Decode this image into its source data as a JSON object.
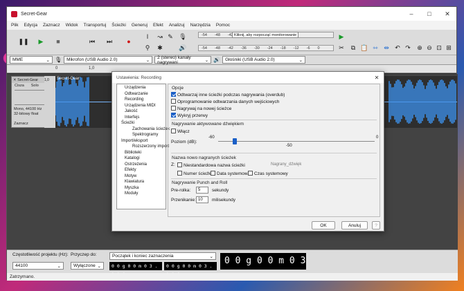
{
  "window": {
    "title": "Secret-Gear"
  },
  "menu": [
    "Plik",
    "Edycja",
    "Zaznacz",
    "Widok",
    "Transportuj",
    "Ścieżki",
    "Generuj",
    "Efekt",
    "Analizuj",
    "Narzędzia",
    "Pomoc"
  ],
  "meters": {
    "rec_ticks": [
      "-54",
      "-48",
      "-42"
    ],
    "rec_hint": "Kliknij, aby rozpocząć monitorowanie",
    "rec_ticks2": [
      "-18",
      "-12",
      "-6",
      "0"
    ],
    "play_ticks": [
      "-54",
      "-48",
      "-42",
      "-36",
      "-30",
      "-24",
      "-18",
      "-12",
      "-6",
      "0"
    ]
  },
  "devices": {
    "host": "MME",
    "mic": "Mikrofon (USB Audio 2.0)",
    "channels": "2 (stereo) kanały nagrywani",
    "speaker": "Głośniki (USB Audio 2.0)"
  },
  "ruler": {
    "labels": [
      "0",
      "1,0"
    ]
  },
  "track": {
    "name": "Secret-Gear",
    "mute": "Cisza",
    "solo": "Solo",
    "info": "Mono, 44100 Hz\n32-bitowy float",
    "select": "Zaznacz",
    "scale": [
      "1,0",
      "0,5",
      "0,0",
      "-0,5",
      "-1,0"
    ]
  },
  "wave_label": "Secret-Gear",
  "dialog": {
    "title": "Ustawienia: Recording",
    "tree": [
      "Urządzenia",
      "Odtwarzanie",
      "Recording",
      "Urządzenia MIDI",
      "Jakość",
      "Interfejs",
      "Ścieżki",
      "Zachowania ścieżek",
      "Spektrogramy",
      "Import/eksport",
      "Rozszerzony import",
      "Biblioteki",
      "Katalogi",
      "Ostrzeżenia",
      "Efekty",
      "Motyw",
      "Klawiatura",
      "Myszka",
      "Moduły"
    ],
    "opcje": "Opcje",
    "opt1": "Odtwarzaj inne ścieżki podczas nagrywania (overdub)",
    "opt2": "Oprogramowanie odtwarzania danych wejściowych",
    "opt3": "Nagrywaj na nowej ścieżce",
    "opt4": "Wykryj przerwy",
    "sound_group": "Nagrywanie aktywowane dźwiękiem",
    "enable": "Włącz",
    "level_label": "Poziom (dB):",
    "level_min": "-60",
    "level_max": "0",
    "level_value": "-50",
    "name_group": "Nazwa nowo nagranych ścieżek",
    "custom_prefix": "Z:",
    "custom_name": "Niestandardowa nazwa ścieżki",
    "custom_value": "Nagrany_dźwięk",
    "track_num": "Numer ścieżki",
    "sys_date": "Data systemowa",
    "sys_time": "Czas systemowy",
    "punch_group": "Nagrywanie Punch and Roll",
    "preroll_label": "Pre-rolka:",
    "preroll_value": "5",
    "preroll_unit": "sekundy",
    "crossfade_label": "Przenikanie:",
    "crossfade_value": "10",
    "crossfade_unit": "milisekundy",
    "ok": "OK",
    "cancel": "Anuluj",
    "help": "?"
  },
  "bottom": {
    "rate_label": "Częstotliwość projektu (Hz):",
    "rate": "44100",
    "snap_label": "Przyczep do:",
    "snap": "Wyłączone",
    "sel_mode": "Początek i koniec zaznaczenia",
    "t1": "0 0 g 0 0 m 0 3 . 1 1 6 s",
    "t2": "0 0 g 0 0 m 0 3 . 1 1 6 s",
    "big": "0 0 g 0 0 m 0 3 s"
  },
  "status": "Zatrzymano."
}
